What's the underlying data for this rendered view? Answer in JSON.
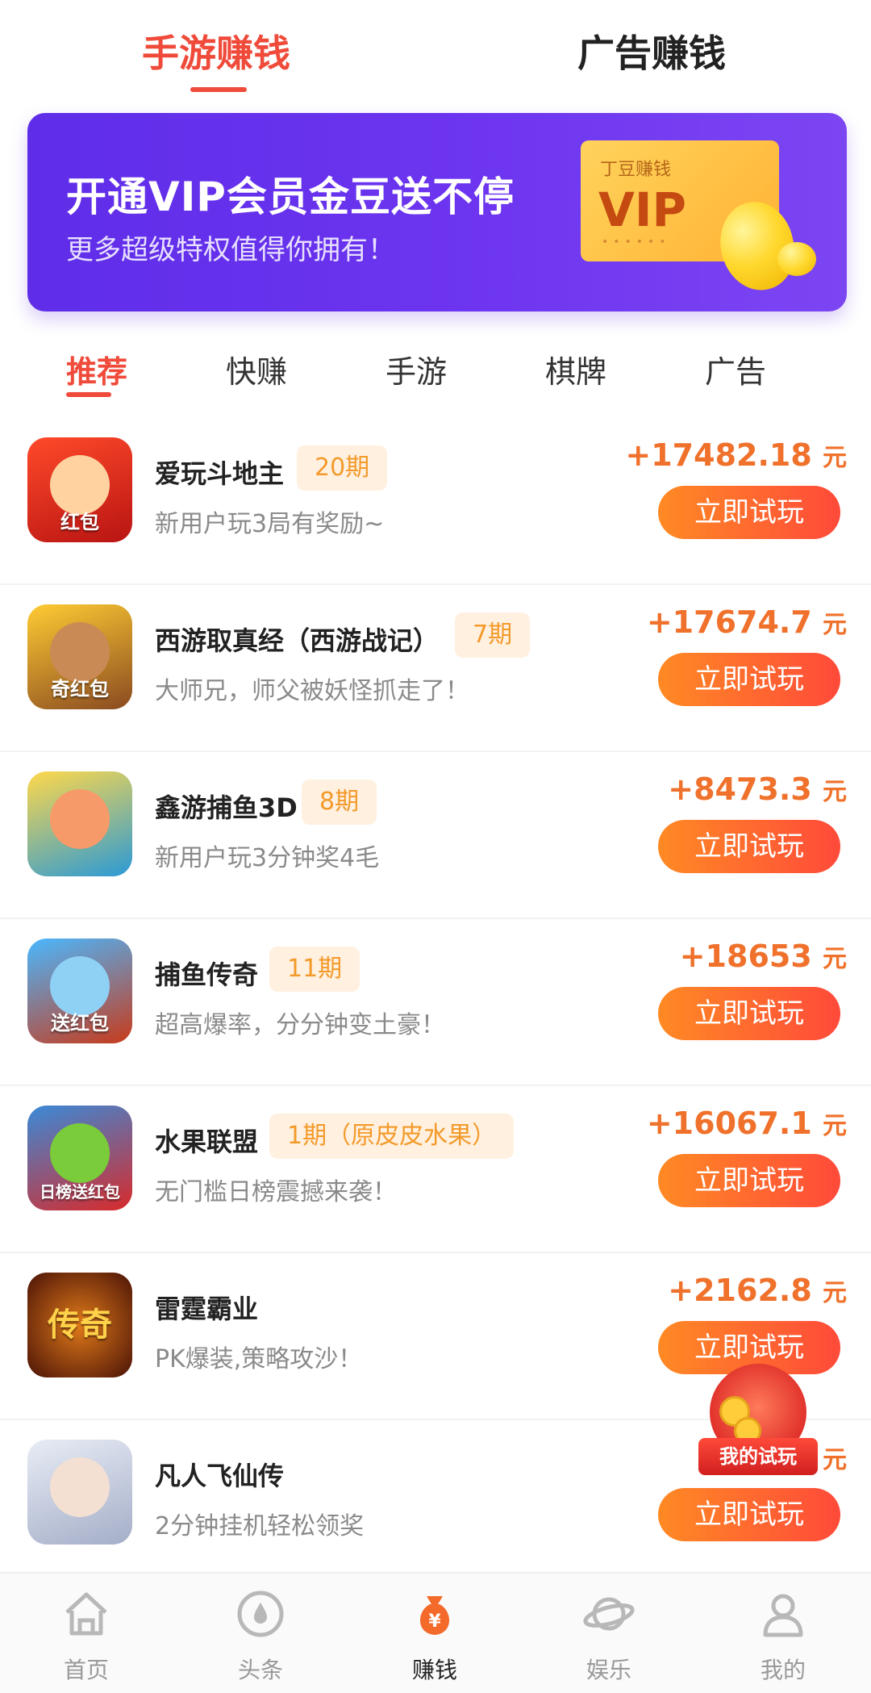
{
  "top_tabs": [
    {
      "label": "手游赚钱",
      "active": true
    },
    {
      "label": "广告赚钱",
      "active": false
    }
  ],
  "banner": {
    "title": "开通VIP会员金豆送不停",
    "subtitle": "更多超级特权值得你拥有！",
    "card_small": "丁豆赚钱",
    "card_big": "VIP"
  },
  "categories": [
    "推荐",
    "快赚",
    "手游",
    "棋牌",
    "广告"
  ],
  "games": [
    {
      "name": "爱玩斗地主",
      "period": "20期",
      "desc": "新用户玩3局有奖励~",
      "reward": "+17482.18",
      "unit": "元",
      "button": "立即试玩",
      "icon_text": "红包",
      "icon_color": "#d8261e"
    },
    {
      "name": "西游取真经（西游战记）",
      "period": "7期",
      "desc": "大师兄，师父被妖怪抓走了！",
      "reward": "+17674.7",
      "unit": "元",
      "button": "立即试玩",
      "icon_text": "奇红包",
      "icon_color": "#8a4a20"
    },
    {
      "name": "鑫游捕鱼3D",
      "period": "8期",
      "desc": "新用户玩3分钟奖4毛",
      "reward": "+8473.3",
      "unit": "元",
      "button": "立即试玩",
      "icon_text": "",
      "icon_color": "#2a9ad6"
    },
    {
      "name": "捕鱼传奇",
      "period": "11期",
      "desc": "超高爆率，分分钟变土豪！",
      "reward": "+18653",
      "unit": "元",
      "button": "立即试玩",
      "icon_text": "送红包",
      "icon_color": "#1a6fc8"
    },
    {
      "name": "水果联盟",
      "period": "1期（原皮皮水果）",
      "desc": "无门槛日榜震撼来袭！",
      "reward": "+16067.1",
      "unit": "元",
      "button": "立即试玩",
      "icon_text": "日榜送红包",
      "icon_color": "#2e86de"
    },
    {
      "name": "雷霆霸业",
      "period": "",
      "desc": "PK爆装,策略攻沙！",
      "reward": "+2162.8",
      "unit": "元",
      "button": "立即试玩",
      "icon_text": "传奇",
      "icon_color": "#5a1a0a"
    },
    {
      "name": "凡人飞仙传",
      "period": "",
      "desc": "2分钟挂机轻松领奖",
      "reward": "+2",
      "unit": "元",
      "button": "立即试玩",
      "icon_text": "",
      "icon_color": "#c9cfe0"
    }
  ],
  "floating_widget": {
    "label": "我的试玩"
  },
  "bottom_nav": [
    {
      "label": "首页",
      "icon": "home-icon",
      "active": false
    },
    {
      "label": "头条",
      "icon": "drop-icon",
      "active": false
    },
    {
      "label": "赚钱",
      "icon": "money-bag-icon",
      "active": true
    },
    {
      "label": "娱乐",
      "icon": "planet-icon",
      "active": false
    },
    {
      "label": "我的",
      "icon": "user-icon",
      "active": false
    }
  ],
  "colors": {
    "accent": "#ef4a3a",
    "reward": "#f0712b",
    "button_start": "#ff8a24",
    "button_end": "#ff4a3a",
    "banner": "#6d35f0"
  }
}
